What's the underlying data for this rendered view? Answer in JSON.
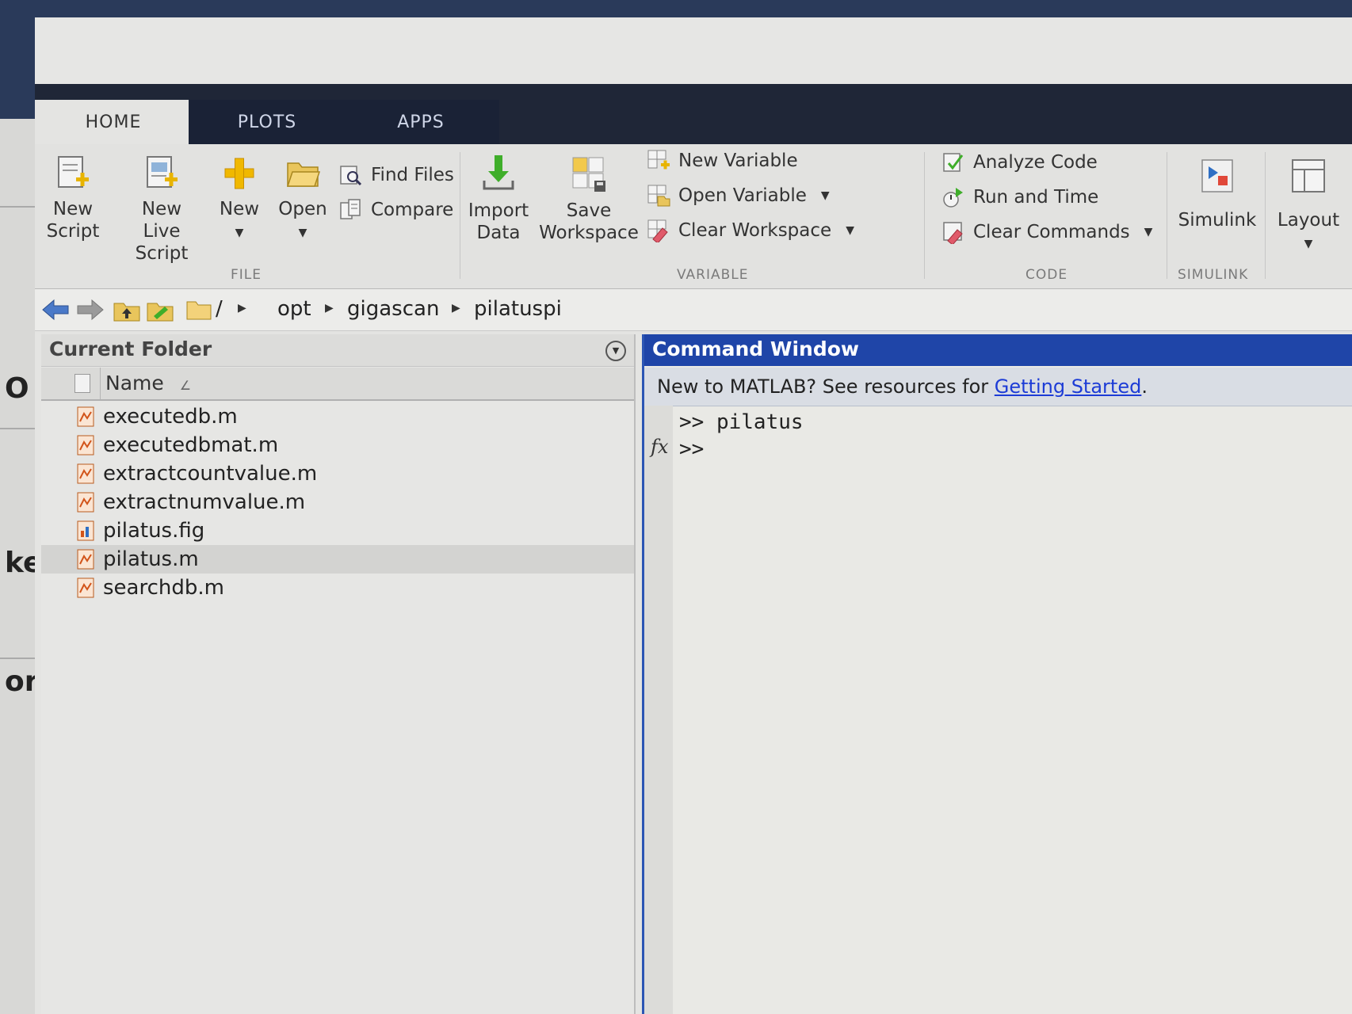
{
  "tabs": [
    "HOME",
    "PLOTS",
    "APPS"
  ],
  "ribbon": {
    "file": {
      "new_script": [
        "New",
        "Script"
      ],
      "new_live_script": [
        "New",
        "Live Script"
      ],
      "new": "New",
      "open": "Open",
      "find_files": "Find Files",
      "compare": "Compare",
      "label": "FILE"
    },
    "variable": {
      "import_data": [
        "Import",
        "Data"
      ],
      "save_workspace": [
        "Save",
        "Workspace"
      ],
      "new_variable": "New Variable",
      "open_variable": "Open Variable",
      "clear_workspace": "Clear Workspace",
      "label": "VARIABLE"
    },
    "code": {
      "analyze_code": "Analyze Code",
      "run_and_time": "Run and Time",
      "clear_commands": "Clear Commands",
      "label": "CODE"
    },
    "simulink": {
      "simulink": "Simulink",
      "label": "SIMULINK"
    },
    "layout": "Layout"
  },
  "address": {
    "root": "/",
    "crumbs": [
      "opt",
      "gigascan",
      "pilatuspi"
    ]
  },
  "current_folder": {
    "title": "Current Folder",
    "column_name": "Name",
    "files": [
      "executedb.m",
      "executedbmat.m",
      "extractcountvalue.m",
      "extractnumvalue.m",
      "pilatus.fig",
      "pilatus.m",
      "searchdb.m"
    ],
    "selected": "pilatus.m"
  },
  "command_window": {
    "title": "Command Window",
    "notice_prefix": "New to MATLAB? See resources for ",
    "notice_link": "Getting Started",
    "notice_suffix": ".",
    "lines": [
      ">> pilatus",
      ">>"
    ],
    "fx": "fx"
  },
  "background_fragments": [
    "O",
    "ke",
    "or"
  ],
  "colors": {
    "tabstrip": "#1f2637",
    "command_title": "#1f45a8",
    "link": "#1d3cd6"
  }
}
